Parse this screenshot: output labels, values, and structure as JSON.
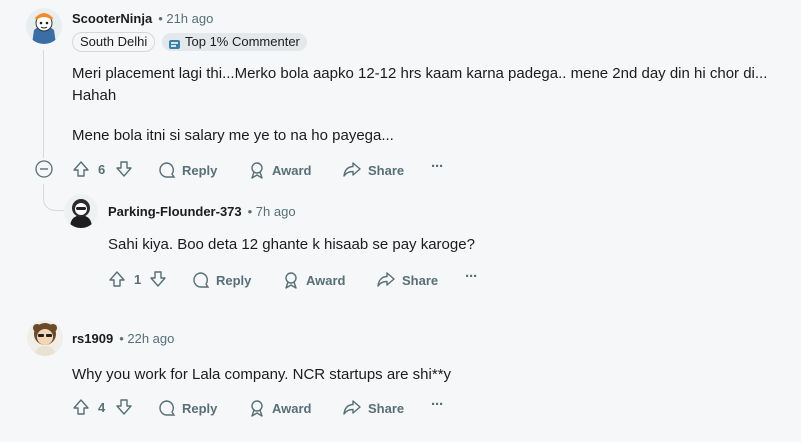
{
  "comments": [
    {
      "username": "ScooterNinja",
      "time": "• 21h ago",
      "flairs": [
        "South Delhi",
        "Top 1% Commenter"
      ],
      "body": [
        "Meri placement lagi thi...Merko bola aapko 12-12 hrs kaam karna padega.. mene 2nd day din hi chor di...",
        "Hahah",
        "Mene bola itni si salary me ye to na ho payega..."
      ],
      "votes": "6",
      "reply_label": "Reply",
      "award_label": "Award",
      "share_label": "Share",
      "more_label": "···"
    },
    {
      "username": "Parking-Flounder-373",
      "time": "• 7h ago",
      "body": [
        "Sahi kiya. Boo deta 12 ghante k hisaab se pay karoge?"
      ],
      "votes": "1",
      "reply_label": "Reply",
      "award_label": "Award",
      "share_label": "Share",
      "more_label": "···"
    },
    {
      "username": "rs1909",
      "time": "• 22h ago",
      "body": [
        "Why you work for Lala company. NCR startups are shi**y"
      ],
      "votes": "4",
      "reply_label": "Reply",
      "award_label": "Award",
      "share_label": "Share",
      "more_label": "···"
    }
  ],
  "colors": {
    "background": "#f6f7f8",
    "meta_text": "#576f76",
    "flair_bg": "#e4e8ea"
  }
}
